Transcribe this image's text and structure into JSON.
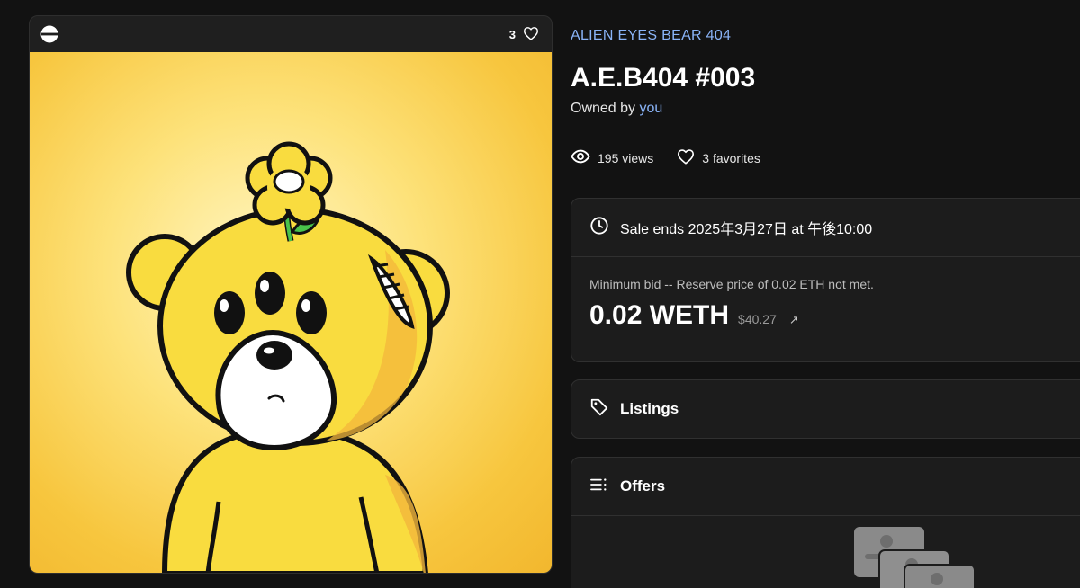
{
  "media": {
    "favorite_count": "3"
  },
  "item": {
    "collection": "ALIEN EYES BEAR 404",
    "title": "A.E.B404 #003",
    "owned_prefix": "Owned by ",
    "owner": "you"
  },
  "stats": {
    "views": "195 views",
    "favorites": "3 favorites"
  },
  "sale": {
    "ends_text": "Sale ends 2025年3月27日 at 午後10:00",
    "min_bid_text": "Minimum bid -- Reserve price of 0.02 ETH not met.",
    "price": "0.02 WETH",
    "usd": "$40.27"
  },
  "listings": {
    "label": "Listings"
  },
  "offers": {
    "label": "Offers"
  },
  "colors": {
    "background": "#121212",
    "panel": "#1c1c1c",
    "link": "#8ab4f8",
    "art_yellow": "#f7c63e"
  },
  "icons": {
    "chain": "chain-icon",
    "favorite": "heart-icon",
    "views": "eye-icon",
    "clock": "clock-icon",
    "tag": "tag-icon",
    "offers": "list-icon",
    "external": "arrow-up-right-icon"
  }
}
